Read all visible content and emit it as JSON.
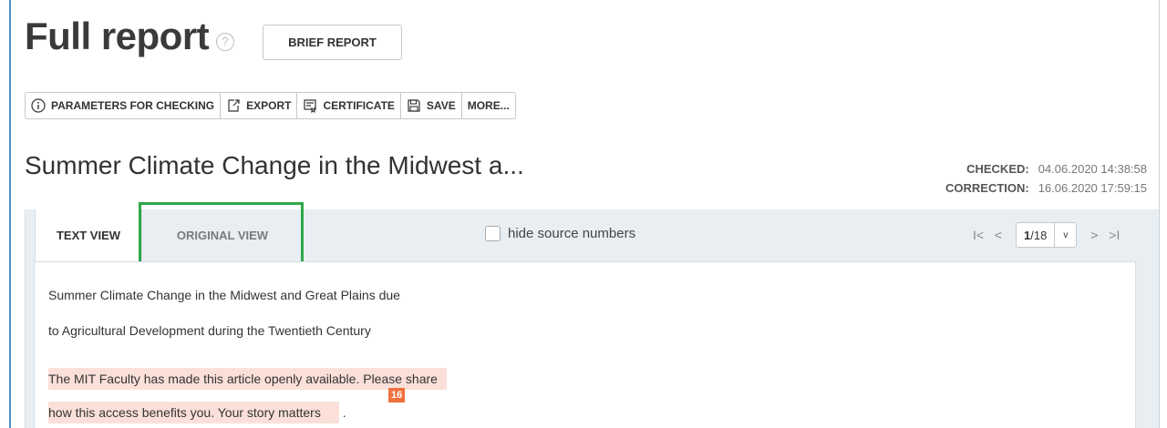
{
  "header": {
    "title": "Full report",
    "help_icon": "?",
    "brief_button": "BRIEF REPORT"
  },
  "toolbar": {
    "items": [
      {
        "label": "PARAMETERS FOR CHECKING",
        "icon": "info-icon"
      },
      {
        "label": "EXPORT",
        "icon": "export-icon"
      },
      {
        "label": "CERTIFICATE",
        "icon": "certificate-icon"
      },
      {
        "label": "SAVE",
        "icon": "save-icon"
      },
      {
        "label": "MORE..."
      }
    ]
  },
  "document": {
    "title": "Summer Climate Change in the Midwest a...",
    "checked_label": "CHECKED:",
    "checked_value": "04.06.2020 14:38:58",
    "correction_label": "CORRECTION:",
    "correction_value": "16.06.2020 17:59:15"
  },
  "tabs": [
    {
      "label": "TEXT VIEW",
      "active": true
    },
    {
      "label": "ORIGINAL VIEW",
      "active": false
    }
  ],
  "options": {
    "hide_source_numbers_label": "hide source numbers",
    "hide_source_numbers_checked": false
  },
  "pager": {
    "first": "I<",
    "prev": "<",
    "current": "1",
    "total": "/18",
    "dropdown": "v",
    "next": ">",
    "last": ">I"
  },
  "content": {
    "lines": [
      "Summer Climate Change in the Midwest and Great Plains due",
      "to Agricultural Development during the Twentieth Century",
      "The MIT Faculty has made this article openly available. Please share",
      "how this access benefits you. Your story matters"
    ],
    "trailing": ".",
    "source_badge": "16"
  },
  "colors": {
    "highlight": "#fbe0d9",
    "badge": "#f0703e",
    "selection_box": "#2ea84a"
  }
}
